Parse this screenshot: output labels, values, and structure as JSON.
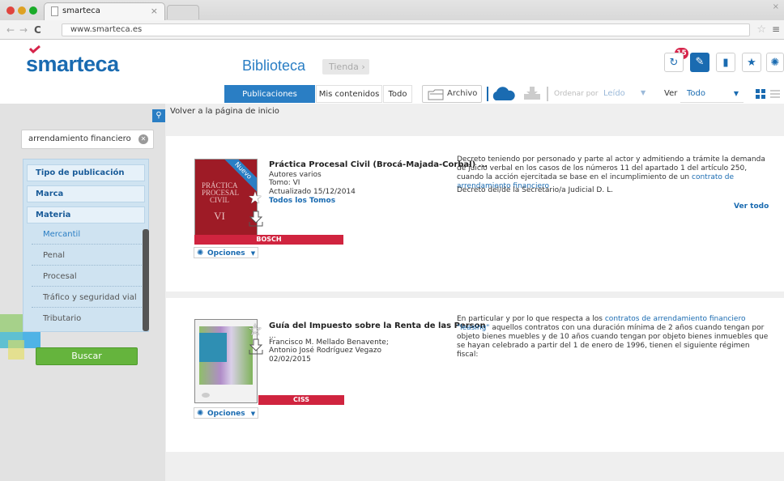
{
  "browser": {
    "tab_title": "smarteca",
    "tab_close": "×",
    "url": "www.smarteca.es"
  },
  "header": {
    "logo": "smarteca",
    "title": "Biblioteca",
    "tienda": "Tienda ›",
    "notifications_count": "15",
    "icons": [
      "refresh-icon",
      "tag-icon",
      "bookmark-icon",
      "star-icon",
      "gear-icon"
    ]
  },
  "toolbar": {
    "tabs": [
      "Publicaciones smarteca",
      "Mis contenidos",
      "Todo"
    ],
    "archivo": "Archivo",
    "ordenar_label": "Ordenar por",
    "ordenar_value": "Leído",
    "ver_label": "Ver",
    "ver_value": "Todo"
  },
  "sidebar": {
    "search_value": "arrendamiento financiero",
    "facet_headers": [
      "Tipo de publicación",
      "Marca",
      "Materia"
    ],
    "materia_items": [
      "Mercantil",
      "Penal",
      "Procesal",
      "Tráfico y seguridad vial",
      "Tributario"
    ],
    "search_button": "Buscar"
  },
  "main": {
    "back_link": "Volver a la página de inicio",
    "results": [
      {
        "badge": "Nuevo",
        "cover_lines": [
          "PRÁCTICA",
          "PROCESAL",
          "CIVIL",
          "VI"
        ],
        "publisher": "BOSCH",
        "options": "Opciones",
        "title": "Práctica Procesal Civil (Brocá-Majada-Corbal) ...",
        "authors": "Autores varios",
        "tomo": "Tomo: VI",
        "updated": "Actualizado 15/12/2014",
        "all_volumes": "Todos los Tomos",
        "excerpt_1": "Decreto teniendo por personado y parte al actor y admitiendo a trámite la demanda de juicio verbal en los casos de los números 11 del apartado 1 del artículo 250, cuando la acción ejercitada se base en el incumplimiento de un ",
        "excerpt_1_hl": "contrato de arrendamiento financiero",
        "excerpt_2": "Decreto del/de la Secretario/a Judicial D. L.",
        "see_all": "Ver todo"
      },
      {
        "publisher": "CISS",
        "options": "Opciones",
        "title": "Guía del Impuesto sobre la Renta de las Person",
        "title_more": "...",
        "authors": "Francisco M. Mellado Benavente; Antonio José Rodríguez Vegazo",
        "date": "02/02/2015",
        "excerpt_1": "En particular y por lo que respecta a los ",
        "excerpt_1_hl": "contratos de arrendamiento financiero \"leasing\"",
        "excerpt_2": " aquellos contratos con una duración mínima de 2 años cuando tengan por objeto bienes muebles y de 10 años cuando tengan por objeto bienes inmuebles que se hayan celebrado a partir del 1 de enero de 1996, tienen el siguiente régimen fiscal:"
      }
    ]
  }
}
